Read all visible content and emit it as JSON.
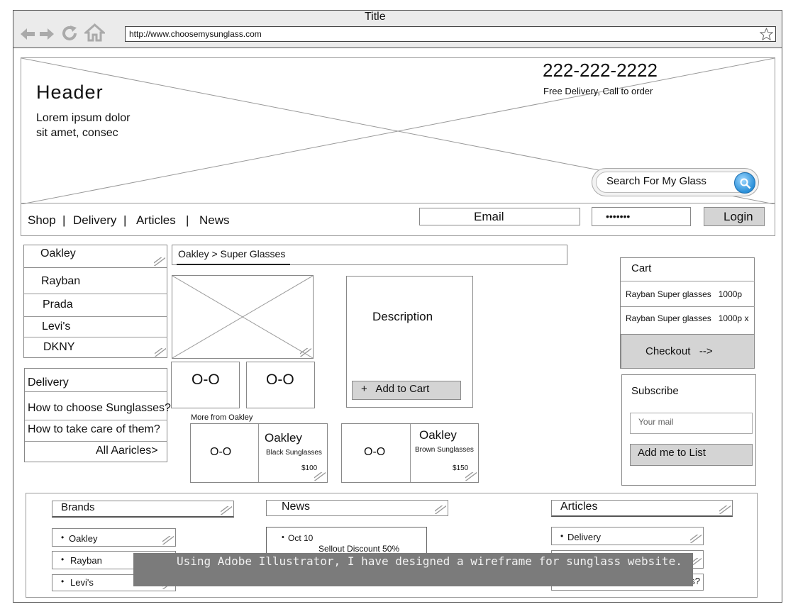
{
  "browser": {
    "title": "Title",
    "url": "http://www.choosemysunglass.com"
  },
  "header": {
    "title": "Header",
    "subtitle_line1": "Lorem ipsum dolor",
    "subtitle_line2": "sit amet, consec",
    "phone": "222-222-2222",
    "phone_note": "Free Delivery, Call to order",
    "search_placeholder": "Search For My Glass"
  },
  "nav": {
    "items": [
      "Shop",
      "Delivery",
      "Articles",
      "News"
    ],
    "separator": "|",
    "email_placeholder": "Email",
    "password_value": "•••••••",
    "login_label": "Login"
  },
  "brands_sidebar": [
    "Oakley",
    "Rayban",
    "Prada",
    "Levi's",
    "DKNY"
  ],
  "articles_sidebar": {
    "heading": "Delivery",
    "items": [
      "How to choose Sunglasses?",
      "How to take care of them?"
    ],
    "all_link": "All Aaricles>"
  },
  "breadcrumb": "Oakley > Super Glasses",
  "product": {
    "thumb_1": "O-O",
    "thumb_2": "O-O",
    "description": "Description",
    "add_to_cart": "+   Add to Cart"
  },
  "more_from": {
    "heading": "More from Oakley",
    "items": [
      {
        "thumb": "O-O",
        "brand": "Oakley",
        "name": "Black Sunglasses",
        "price": "$100"
      },
      {
        "thumb": "O-O",
        "brand": "Oakley",
        "name": "Brown Sunglasses",
        "price": "$150"
      }
    ]
  },
  "cart": {
    "title": "Cart",
    "items": [
      "Rayban Super glasses   1000p",
      "Rayban Super glasses   1000p x"
    ],
    "checkout": "Checkout   -->"
  },
  "subscribe": {
    "title": "Subscribe",
    "placeholder": "Your mail",
    "button": "Add me to List"
  },
  "footer": {
    "brands_title": "Brands",
    "brands": [
      "Oakley",
      "Rayban",
      "Levi's"
    ],
    "news_title": "News",
    "news_date": "Oct 10",
    "news_text": "Sellout Discount 50%",
    "articles_title": "Articles",
    "articles": [
      "Delivery",
      "",
      "es?"
    ]
  },
  "caption": "Using Adobe Illustrator, I have designed a wireframe for sunglass website.",
  "colors": {
    "border": "#9a9a9a",
    "gray_fill": "#d4d4d4",
    "caption_bg": "#7b7b7b",
    "search_icon": "#2a8fd8"
  }
}
